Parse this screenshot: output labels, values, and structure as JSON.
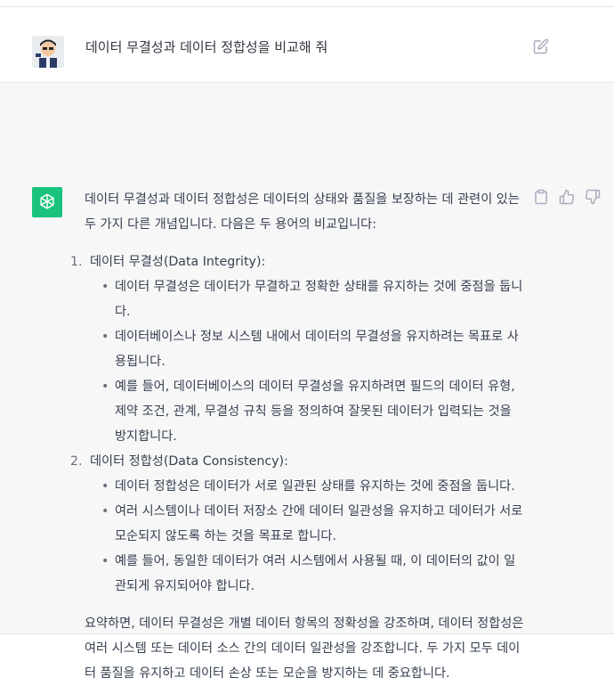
{
  "user_message": {
    "text": "데이터 무결성과 데이터 정합성을 비교해 줘"
  },
  "assistant": {
    "intro": "데이터 무결성과 데이터 정합성은 데이터의 상태와 품질을 보장하는 데 관련이 있는 두 가지 다른 개념입니다. 다음은 두 용어의 비교입니다:",
    "sections": [
      {
        "number": "1.",
        "title": "데이터 무결성(Data Integrity):",
        "bullets": [
          "데이터 무결성은 데이터가 무결하고 정확한 상태를 유지하는 것에 중점을 둡니다.",
          "데이터베이스나 정보 시스템 내에서 데이터의 무결성을 유지하려는 목표로 사용됩니다.",
          "예를 들어, 데이터베이스의 데이터 무결성을 유지하려면 필드의 데이터 유형, 제약 조건, 관계, 무결성 규칙 등을 정의하여 잘못된 데이터가 입력되는 것을 방지합니다."
        ]
      },
      {
        "number": "2.",
        "title": "데이터 정합성(Data Consistency):",
        "bullets": [
          "데이터 정합성은 데이터가 서로 일관된 상태를 유지하는 것에 중점을 둡니다.",
          "여러 시스템이나 데이터 저장소 간에 데이터 일관성을 유지하고 데이터가 서로 모순되지 않도록 하는 것을 목표로 합니다.",
          "예를 들어, 동일한 데이터가 여러 시스템에서 사용될 때, 이 데이터의 값이 일관되게 유지되어야 합니다."
        ]
      }
    ],
    "summary": "요약하면, 데이터 무결성은 개별 데이터 항목의 정확성을 강조하며, 데이터 정합성은 여러 시스템 또는 데이터 소스 간의 데이터 일관성을 강조합니다. 두 가지 모두 데이터 품질을 유지하고 데이터 손상 또는 모순을 방지하는 데 중요합니다."
  },
  "icons": {
    "user_avatar": "user-avatar",
    "assistant_avatar": "openai-logo-icon",
    "edit": "edit-icon",
    "copy": "clipboard-icon",
    "like": "thumbs-up-icon",
    "dislike": "thumbs-down-icon"
  },
  "colors": {
    "assistant_avatar_bg": "#19c37d",
    "assistant_row_bg": "#f7f7f8"
  }
}
